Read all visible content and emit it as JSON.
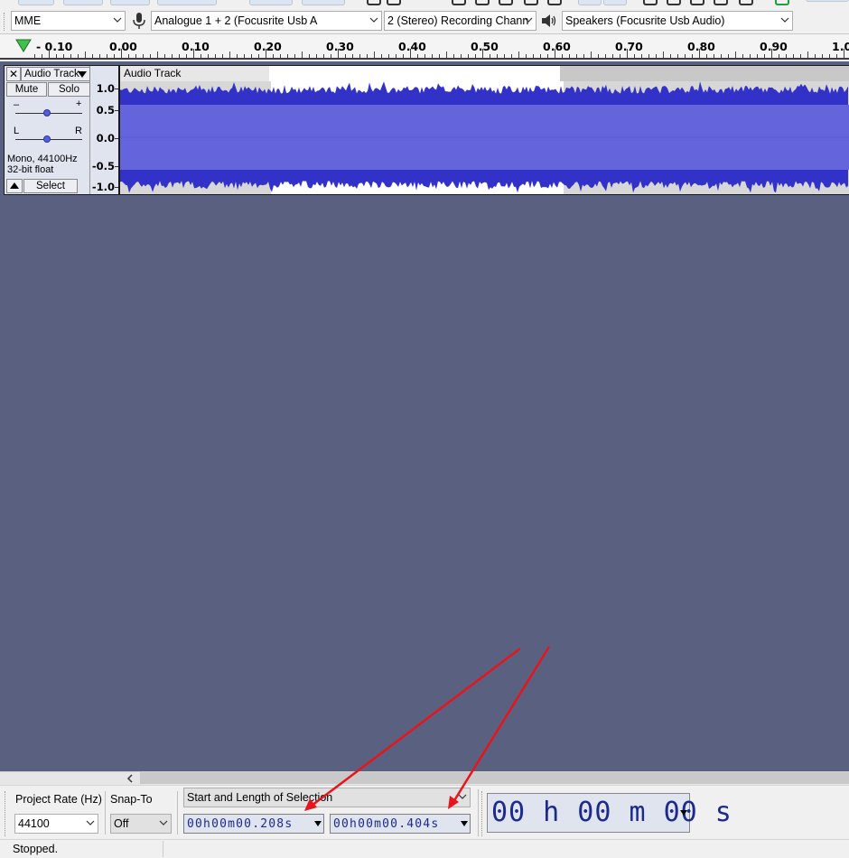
{
  "device_toolbar": {
    "host": "MME",
    "recording_device": "Analogue 1 + 2 (Focusrite Usb A",
    "channels": "2 (Stereo) Recording Chann",
    "playback_device": "Speakers (Focusrite Usb Audio)",
    "mic_icon": "microphone-icon",
    "speaker_icon": "speaker-icon"
  },
  "ruler": {
    "labels": [
      "- 0.10",
      "0.00",
      "0.10",
      "0.20",
      "0.30",
      "0.40",
      "0.50",
      "0.60",
      "0.70",
      "0.80",
      "0.90",
      "1.0"
    ]
  },
  "track": {
    "menu_label": "Audio Track",
    "name_tab": "Audio Track",
    "mute_label": "Mute",
    "solo_label": "Solo",
    "gain_minus": "–",
    "gain_plus": "+",
    "pan_left": "L",
    "pan_right": "R",
    "format_line1": "Mono, 44100Hz",
    "format_line2": "32-bit float",
    "select_label": "Select",
    "vruler": [
      "1.0",
      "0.5",
      "0.0",
      "-0.5",
      "-1.0"
    ],
    "selection_start": 0.208,
    "selection_end": 0.612
  },
  "selection_toolbar": {
    "project_rate_label": "Project Rate (Hz)",
    "snap_to_label": "Snap-To",
    "project_rate_value": "44100",
    "snap_value": "Off",
    "selection_mode": "Start and Length of Selection",
    "start_time": "00h00m00.208s",
    "length_time": "00h00m00.404s",
    "audio_position": "00 h 00 m 00 s"
  },
  "status": {
    "text": "Stopped."
  },
  "colors": {
    "waveform": "#3232c8",
    "waveform_rms": "#6464dc",
    "workspace": "#5a6180",
    "annotation_arrows": "#e8141c"
  }
}
